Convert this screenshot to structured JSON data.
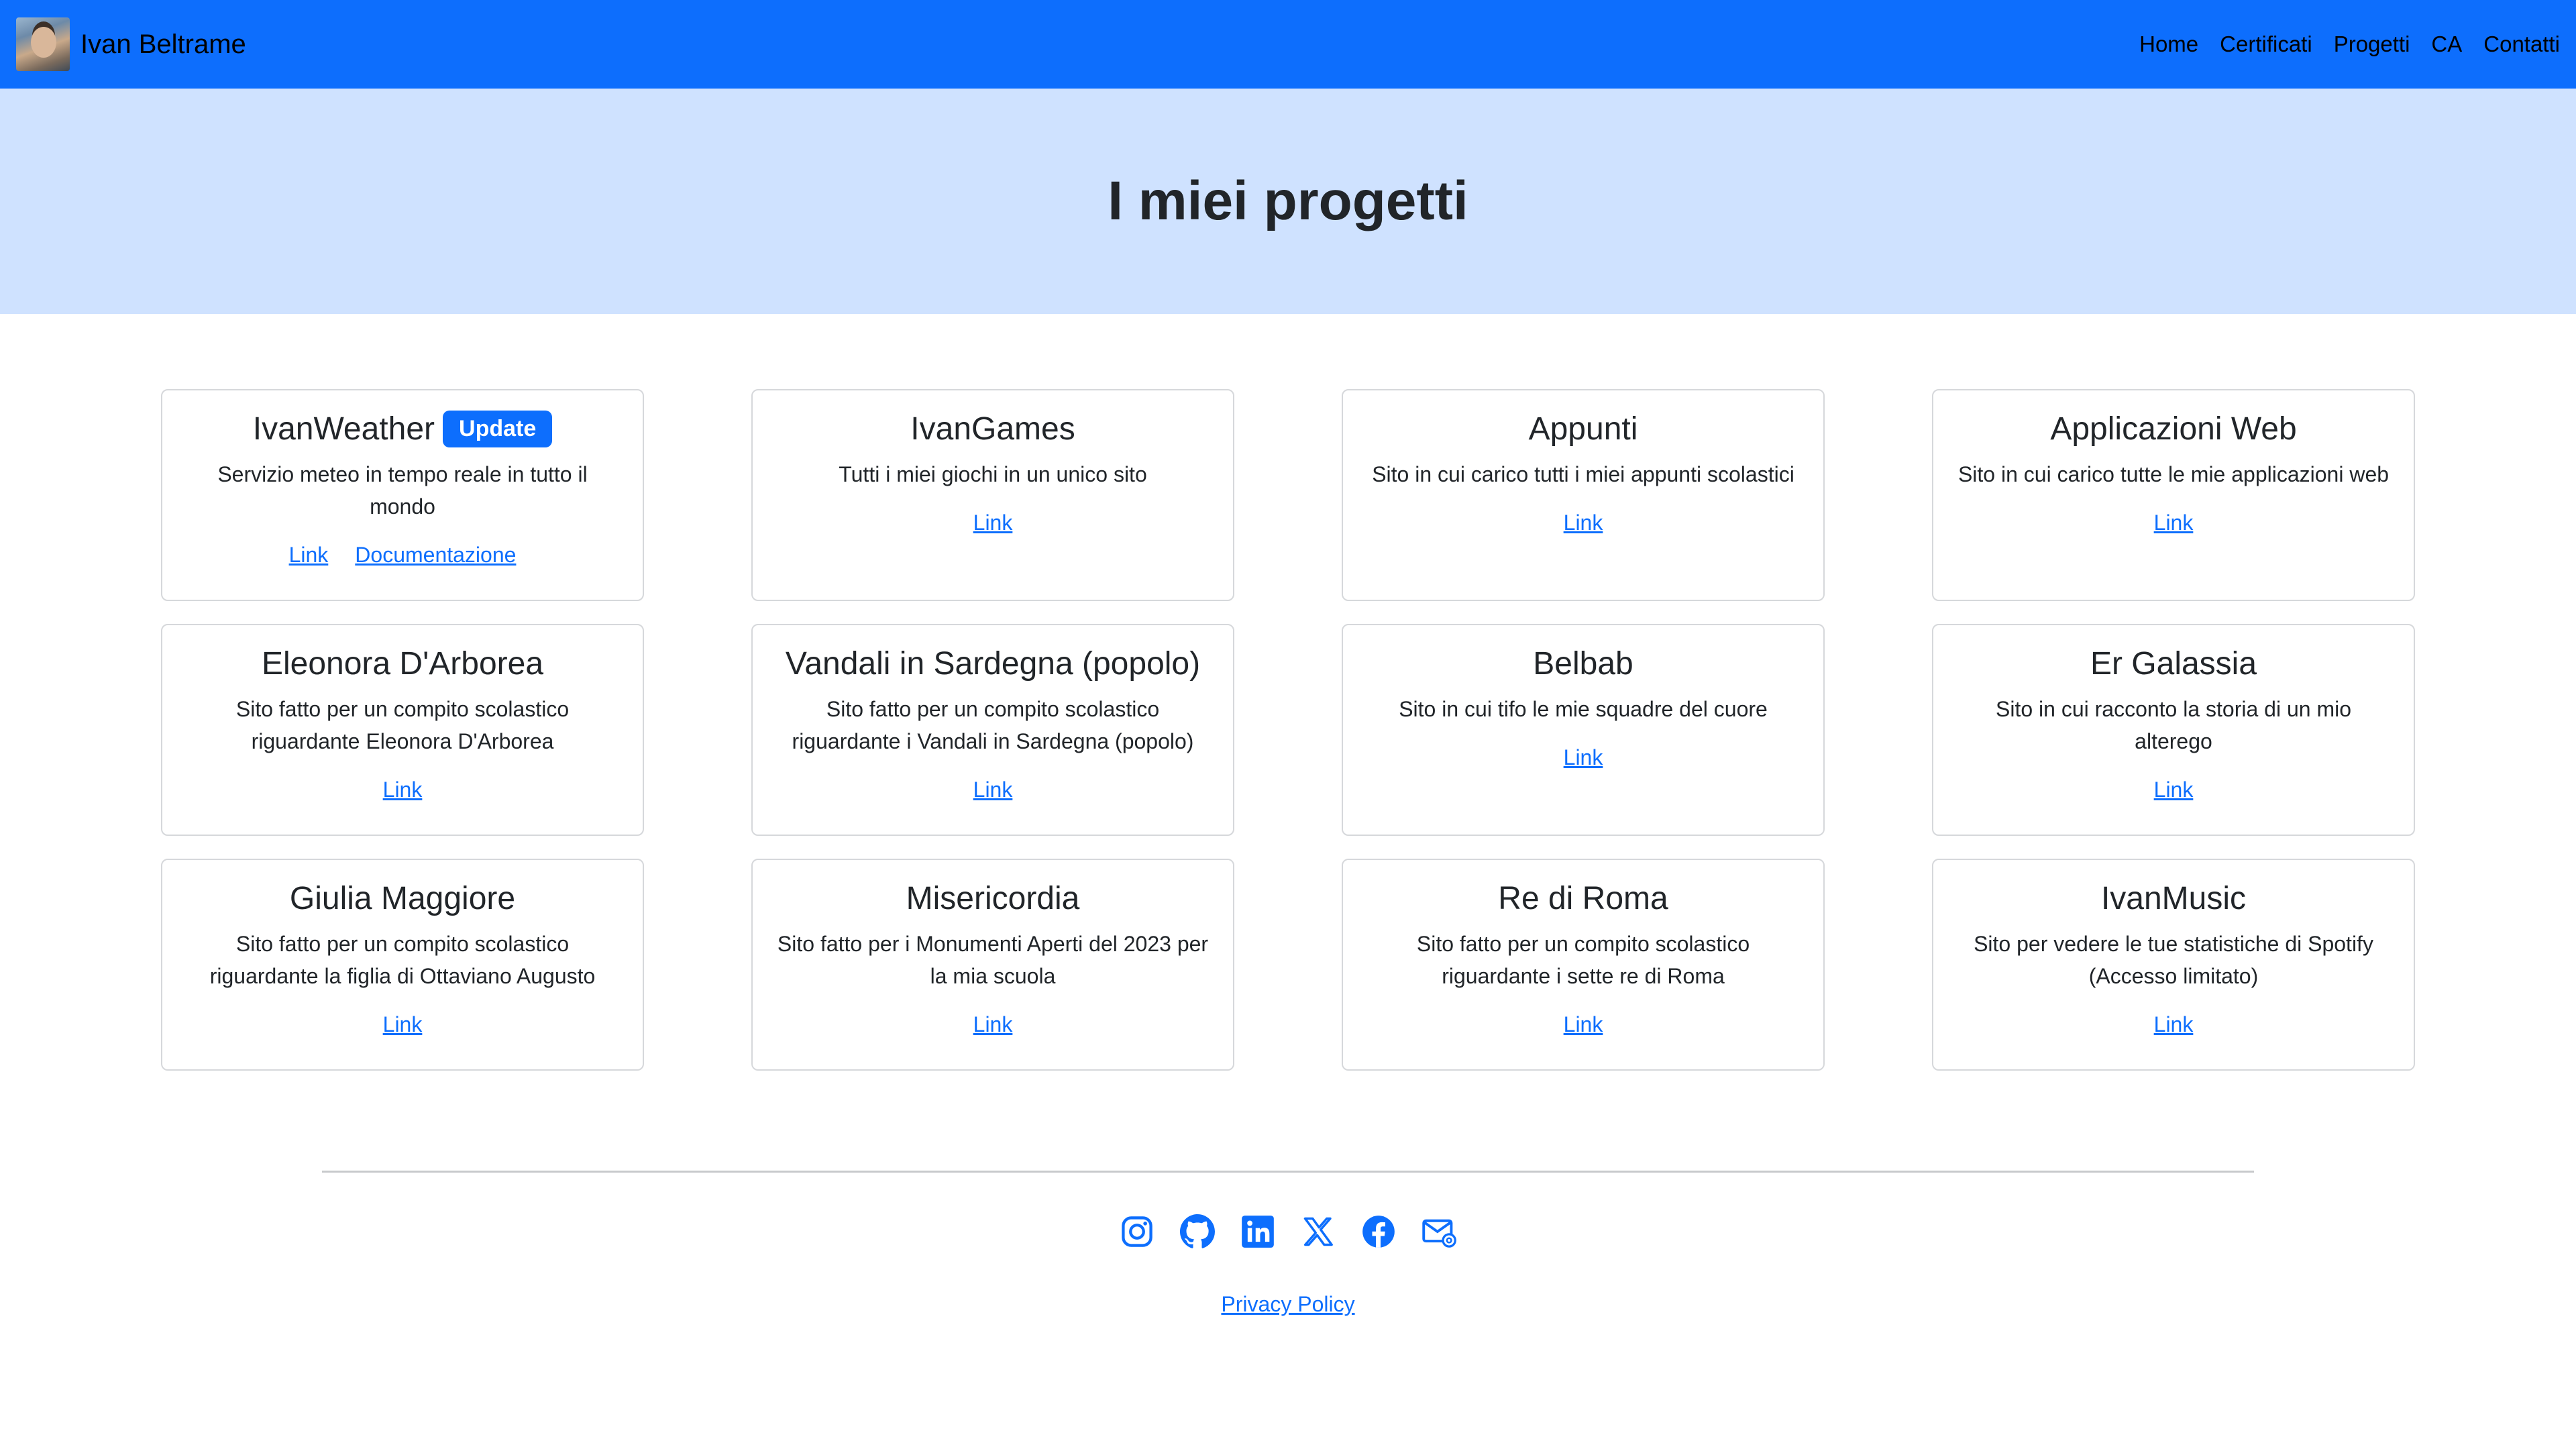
{
  "brand": {
    "name": "Ivan Beltrame"
  },
  "nav": [
    "Home",
    "Certificati",
    "Progetti",
    "CA",
    "Contatti"
  ],
  "hero": {
    "title": "I miei progetti"
  },
  "projects": [
    {
      "title": "IvanWeather",
      "badge": "Update",
      "text": "Servizio meteo in tempo reale in tutto il mondo",
      "links": [
        "Link",
        "Documentazione"
      ]
    },
    {
      "title": "IvanGames",
      "text": "Tutti i miei giochi in un unico sito",
      "links": [
        "Link"
      ]
    },
    {
      "title": "Appunti",
      "text": "Sito in cui carico tutti i miei appunti scolastici",
      "links": [
        "Link"
      ]
    },
    {
      "title": "Applicazioni Web",
      "text": "Sito in cui carico tutte le mie applicazioni web",
      "links": [
        "Link"
      ]
    },
    {
      "title": "Eleonora D'Arborea",
      "text": "Sito fatto per un compito scolastico riguardante Eleonora D'Arborea",
      "links": [
        "Link"
      ]
    },
    {
      "title": "Vandali in Sardegna (popolo)",
      "text": "Sito fatto per un compito scolastico riguardante i Vandali in Sardegna (popolo)",
      "links": [
        "Link"
      ]
    },
    {
      "title": "Belbab",
      "text": "Sito in cui tifo le mie squadre del cuore",
      "links": [
        "Link"
      ]
    },
    {
      "title": "Er Galassia",
      "text": "Sito in cui racconto la storia di un mio alterego",
      "links": [
        "Link"
      ]
    },
    {
      "title": "Giulia Maggiore",
      "text": "Sito fatto per un compito scolastico riguardante la figlia di Ottaviano Augusto",
      "links": [
        "Link"
      ]
    },
    {
      "title": "Misericordia",
      "text": "Sito fatto per i Monumenti Aperti del 2023 per la mia scuola",
      "links": [
        "Link"
      ]
    },
    {
      "title": "Re di Roma",
      "text": "Sito fatto per un compito scolastico riguardante i sette re di Roma",
      "links": [
        "Link"
      ]
    },
    {
      "title": "IvanMusic",
      "text": "Sito per vedere le tue statistiche di Spotify (Accesso limitato)",
      "links": [
        "Link"
      ]
    }
  ],
  "socials": [
    "instagram-icon",
    "github-icon",
    "linkedin-icon",
    "x-icon",
    "facebook-icon",
    "email-icon"
  ],
  "footer": {
    "privacy_label": "Privacy Policy"
  },
  "colors": {
    "primary": "#0d6efd",
    "hero_bg": "#cfe2ff"
  }
}
